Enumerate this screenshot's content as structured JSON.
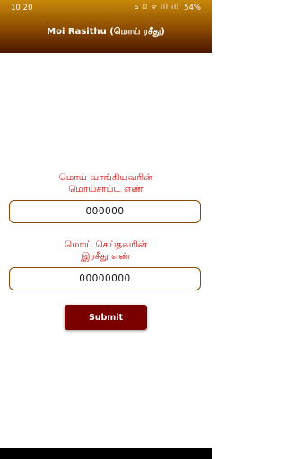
{
  "status_bar": {
    "time": "10:20",
    "icons": "⌂ ⊡ ᯤ ıll ıll",
    "battery": "54%"
  },
  "header": {
    "title": "Moi Rasithu (மொய் ரசீது)"
  },
  "form": {
    "field1_label_line1": "மொய் வாங்கியவரின்",
    "field1_label_line2": "மொய்சாப்ட் எண்",
    "field1_value": "000000",
    "field2_label_line1": "மொய் செய்தவரின்",
    "field2_label_line2": "இரசீது எண்",
    "field2_value": "00000000",
    "submit_label": "Submit"
  },
  "colors": {
    "header_top": "#c8890a",
    "header_bottom": "#4a1600",
    "label": "#d00000",
    "button": "#7a0000",
    "field_border": "#8a4a02"
  }
}
